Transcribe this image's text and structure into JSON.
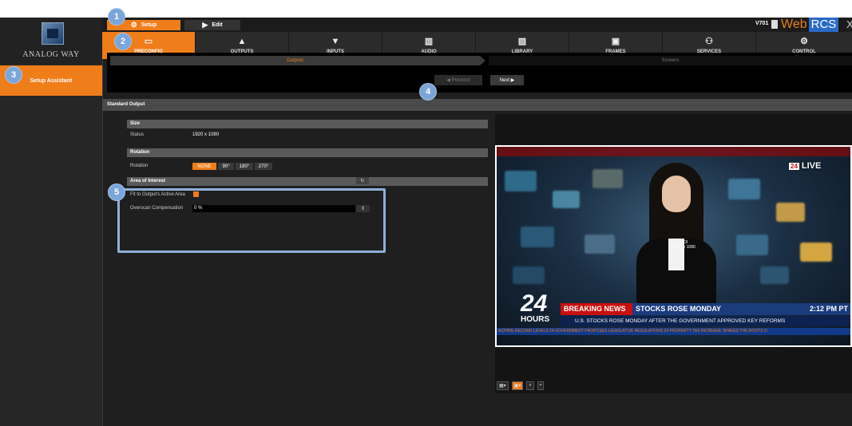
{
  "brand": {
    "logo_text": "ANALOG WAY",
    "version": "V701",
    "product": "Web",
    "product_accent": "RCS",
    "close_glyph": "X",
    "accent_color": "#ef7d1a"
  },
  "modes": {
    "setup": "Setup",
    "edit": "Edit"
  },
  "nav": [
    {
      "label": "PRECONFIG",
      "glyph": "▭",
      "active": true
    },
    {
      "label": "OUTPUTS",
      "glyph": "▲",
      "active": false
    },
    {
      "label": "INPUTS",
      "glyph": "▼",
      "active": false
    },
    {
      "label": "AUDIO",
      "glyph": "▥",
      "active": false
    },
    {
      "label": "LIBRARY",
      "glyph": "▨",
      "active": false
    },
    {
      "label": "FRAMES",
      "glyph": "▣",
      "active": false
    },
    {
      "label": "SERVICES",
      "glyph": "⚇",
      "active": false
    },
    {
      "label": "CONTROL",
      "glyph": "⚙",
      "active": false
    }
  ],
  "sidebar": {
    "setup_assistant": "Setup Assistant"
  },
  "wizard": {
    "step_outputs": "Outputs",
    "step_screens": "Screens",
    "previous": "◀ Previous",
    "next": "Next ▶"
  },
  "section": {
    "title": "Standard Output"
  },
  "size": {
    "header": "Size",
    "status_label": "Status",
    "status_value": "1920 x 1080"
  },
  "rotation": {
    "header": "Rotation",
    "label": "Rotation",
    "options": [
      "NONE",
      "90°",
      "180°",
      "270°"
    ],
    "selected": "NONE"
  },
  "aoi": {
    "header": "Area of Interest",
    "fit_label": "Fit to Output's Active Area",
    "overscan_label": "Overscan Compensation",
    "overscan_value": "0 %"
  },
  "preview": {
    "live_num": "24",
    "live_text": "LIVE",
    "res_label_1": "AOI",
    "res_label_2": "1920 x 1080",
    "big_24": "24",
    "hours": "HOURS",
    "breaking": "BREAKING NEWS",
    "headline": "STOCKS ROSE MONDAY",
    "clock": "2:12 PM PT",
    "ticker_mid": "U.S. STOCKS ROSE MONDAY AFTER THE GOVERNMENT APPROVED KEY REFORMS",
    "ticker_bot": "ACHING RECORD LEVELS   24  GOVERNMENT PROPOSES LEGISLATIVE REGULATIONS   24  PROPERTY TAX INCREASE SHAKES THE ROOTS O"
  },
  "callouts": [
    "1",
    "2",
    "3",
    "4",
    "5"
  ]
}
